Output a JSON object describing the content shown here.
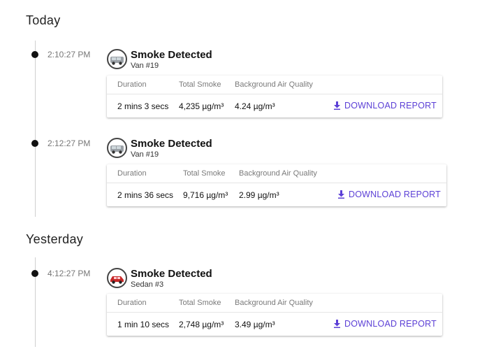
{
  "sections": [
    {
      "label": "Today",
      "events": [
        {
          "time": "2:10:27 PM",
          "title": "Smoke Detected",
          "vehicle": "Van #19",
          "vehicle_icon": "van-icon",
          "headers": [
            "Duration",
            "Total Smoke",
            "Background Air Quality"
          ],
          "values": [
            "2 mins 3 secs",
            "4,235 µg/m³",
            "4.24 µg/m³"
          ],
          "action": "DOWNLOAD REPORT"
        },
        {
          "time": "2:12:27 PM",
          "title": "Smoke Detected",
          "vehicle": "Van #19",
          "vehicle_icon": "van-icon",
          "headers": [
            "Duration",
            "Total Smoke",
            "Background Air Quality"
          ],
          "values": [
            "2 mins 36 secs",
            "9,716 µg/m³",
            "2.99 µg/m³"
          ],
          "action": "DOWNLOAD REPORT"
        }
      ]
    },
    {
      "label": "Yesterday",
      "events": [
        {
          "time": "4:12:27 PM",
          "title": "Smoke Detected",
          "vehicle": "Sedan #3",
          "vehicle_icon": "sedan-icon",
          "headers": [
            "Duration",
            "Total Smoke",
            "Background Air Quality"
          ],
          "values": [
            "1 min 10 secs",
            "2,748 µg/m³",
            "3.49 µg/m³"
          ],
          "action": "DOWNLOAD REPORT"
        }
      ]
    }
  ],
  "colors": {
    "accent": "#5b3fd6",
    "timeline": "#cfcfcf",
    "dot": "#111111"
  }
}
